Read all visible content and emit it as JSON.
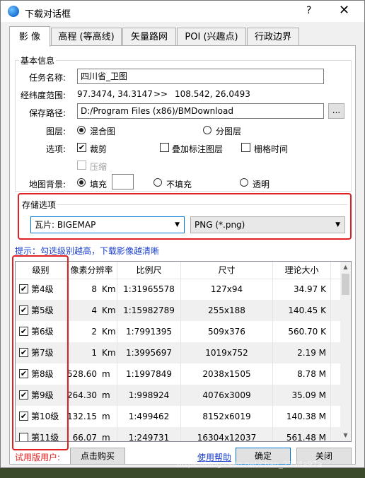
{
  "window": {
    "title": "下载对话框",
    "help": "?",
    "close": "✕"
  },
  "tabs": [
    {
      "label": "影 像",
      "active": true
    },
    {
      "label": "高程 (等高线)"
    },
    {
      "label": "矢量路网"
    },
    {
      "label": "POI (兴趣点)"
    },
    {
      "label": "行政边界"
    }
  ],
  "basic": {
    "legend": "基本信息",
    "task_label": "任务名称:",
    "task_value": "四川省_卫图",
    "range_label": "经纬度范围:",
    "range_from": "97.3474, 34.3147",
    "range_sep": ">>",
    "range_to": "108.542, 26.0493",
    "path_label": "保存路径:",
    "path_value": "D:/Program Files (x86)/BMDownload",
    "browse": "...",
    "layer_label": "图层:",
    "layer_mixed": "混合图",
    "layer_split": "分图层",
    "options_label": "选项:",
    "opt_clip": "裁剪",
    "opt_overlay": "叠加标注图层",
    "opt_grid_time": "栅格时间",
    "opt_compress": "压缩",
    "bg_label": "地图背景:",
    "bg_fill": "填充",
    "bg_nofill": "不填充",
    "bg_transparent": "透明"
  },
  "storage": {
    "legend": "存储选项",
    "tile_value": "瓦片: BIGEMAP",
    "format_value": "PNG (*.png)"
  },
  "hint": "提示：勾选级别越高，下载影像越清晰",
  "table": {
    "columns": [
      "级别",
      "像素分辨率",
      "比例尺",
      "尺寸",
      "理论大小"
    ],
    "rows": [
      {
        "checked": true,
        "level": "第4级",
        "res_val": "8",
        "res_unit": "Km",
        "scale": "1:31965578",
        "size": "127x94",
        "theory": "34.97 K"
      },
      {
        "checked": true,
        "level": "第5级",
        "res_val": "4",
        "res_unit": "Km",
        "scale": "1:15982789",
        "size": "255x188",
        "theory": "140.45 K"
      },
      {
        "checked": true,
        "level": "第6级",
        "res_val": "2",
        "res_unit": "Km",
        "scale": "1:7991395",
        "size": "509x376",
        "theory": "560.70 K"
      },
      {
        "checked": true,
        "level": "第7级",
        "res_val": "1",
        "res_unit": "Km",
        "scale": "1:3995697",
        "size": "1019x752",
        "theory": "2.19 M"
      },
      {
        "checked": true,
        "level": "第8级",
        "res_val": "528.60",
        "res_unit": "m",
        "scale": "1:1997849",
        "size": "2038x1505",
        "theory": "8.78 M"
      },
      {
        "checked": true,
        "level": "第9级",
        "res_val": "264.30",
        "res_unit": "m",
        "scale": "1:998924",
        "size": "4076x3009",
        "theory": "35.09 M"
      },
      {
        "checked": true,
        "level": "第10级",
        "res_val": "132.15",
        "res_unit": "m",
        "scale": "1:499462",
        "size": "8152x6019",
        "theory": "140.38 M"
      },
      {
        "checked": false,
        "level": "第11级",
        "res_val": "66.07",
        "res_unit": "m",
        "scale": "1:249731",
        "size": "16304x12037",
        "theory": "561.48 M"
      }
    ]
  },
  "footer": {
    "trial": "试用版用户:",
    "buy": "点击购买",
    "help": "使用帮助",
    "ok": "确定",
    "close": "关闭"
  },
  "watermark": "https://blog.csdn.net/chan_2534a97a"
}
